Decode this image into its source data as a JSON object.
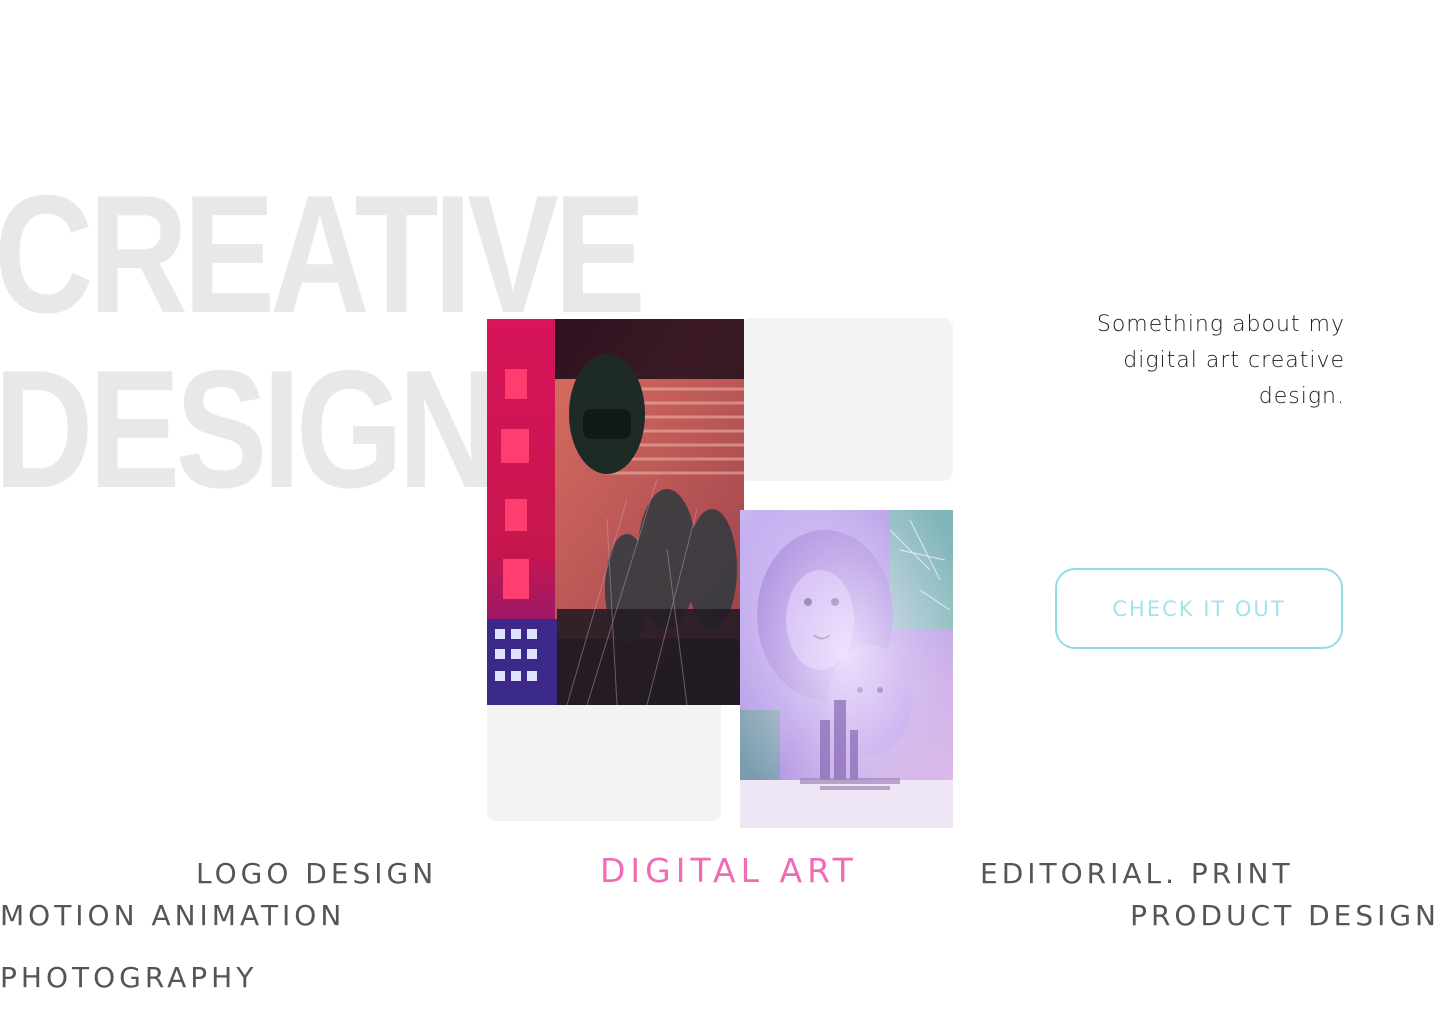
{
  "hero": {
    "line1": "CREATIVE",
    "line2": "DESIGN"
  },
  "about": {
    "text": "Something about my digital art creative design."
  },
  "cta": {
    "label": "CHECK IT OUT"
  },
  "categories": [
    {
      "label": "LOGO DESIGN",
      "active": false
    },
    {
      "label": "DIGITAL ART",
      "active": true
    },
    {
      "label": "EDITORIAL. PRINT",
      "active": false
    },
    {
      "label": "MOTION ANIMATION",
      "active": false
    },
    {
      "label": "PRODUCT DESIGN",
      "active": false
    },
    {
      "label": "PHOTOGRAPHY",
      "active": false
    }
  ],
  "colors": {
    "hero": "#e8e8e8",
    "accent_active": "#f26bb5",
    "cta_border": "#93dbe5",
    "category_text": "#555555",
    "panel": "#f3f3f3"
  },
  "artworks": [
    "neon-street-glitch-art",
    "lion-double-exposure-art"
  ]
}
